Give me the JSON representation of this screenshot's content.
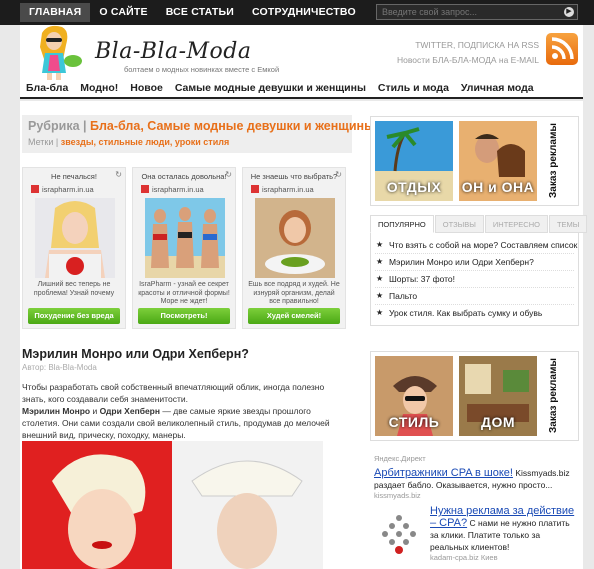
{
  "topnav": {
    "items": [
      "ГЛАВНАЯ",
      "О САЙТЕ",
      "ВСЕ СТАТЬИ",
      "СОТРУДНИЧЕСТВО"
    ],
    "search_placeholder": "Введите свой запрос..."
  },
  "header": {
    "logo": "Bla-Bla-Moda",
    "tagline": "болтаем о модных новинках вместе с Емкой",
    "links_line1": "TWITTER, ПОДПИСКА НА RSS",
    "links_line2": "Новости БЛА-БЛА-МОДА на E-MAIL"
  },
  "catnav": {
    "items": [
      "Бла-бла",
      "Модно!",
      "Новое",
      "Самые модные девушки и женщины",
      "Стиль и мода",
      "Уличная мода"
    ]
  },
  "rubric": {
    "prefix": "Рубрика | ",
    "title": "Бла-бла, Самые модные девушки и женщины",
    "tags_prefix": "Метки | ",
    "tags": "звезды, стильные люди, уроки стиля"
  },
  "ads": [
    {
      "title": "Не печалься!",
      "source": "israpharm.in.ua",
      "text": "Лишний вес теперь не проблема! Узнай почему",
      "button": "Похудение без вреда"
    },
    {
      "title": "Она осталась довольна!",
      "source": "israpharm.in.ua",
      "text": "IsraPharm - узнай ее секрет красоты и отличной формы! Море не ждет!",
      "button": "Посмотреть!"
    },
    {
      "title": "Не знаешь что выбрать?",
      "source": "israpharm.in.ua",
      "text": "Ешь все подряд и худей. Не изнуряй организм, делай все правильно!",
      "button": "Худей смелей!"
    }
  ],
  "article": {
    "title": "Мэрилин Монро или Одри Хепберн?",
    "author": "Автор: Bla-Bla-Moda",
    "p1": "Чтобы разработать свой собственный впечатляющий облик, иногда полезно знать, кого создавали себя знаменитости.",
    "p2_bold1": "Мэрилин Монро",
    "p2_and": " и ",
    "p2_bold2": "Одри Хепберн",
    "p2_rest": " — две самые яркие звезды прошлого столетия. Они сами создали свой великолепный стиль, продумав до мелочей внешний вид, прическу, походку, манеры."
  },
  "side_banner1": {
    "cap1": "ОТДЫХ",
    "cap2": "ОН и ОНА",
    "side": "Заказ рекламы"
  },
  "side_banner2": {
    "cap1": "СТИЛЬ",
    "cap2": "ДОМ",
    "side": "Заказ рекламы"
  },
  "tabs": {
    "labels": [
      "ПОПУЛЯРНО",
      "ОТЗЫВЫ",
      "ИНТЕРЕСНО",
      "ТЕМЫ"
    ],
    "items": [
      "Что взять с собой на море? Составляем список",
      "Мэрилин Монро или Одри Хепберн?",
      "Шорты: 37 фото!",
      "Пальто",
      "Урок стиля. Как выбрать сумку и обувь"
    ]
  },
  "yandex": {
    "label": "Яндекс.Директ",
    "ad1": {
      "headline": "Арбитражники CPA в шоке!",
      "desc_lead": " Kissmyads.biz раздает бабло. Оказывается, нужно просто...",
      "url": "kissmyads.biz"
    },
    "ad2": {
      "headline": "Нужна реклама за действие – CPA?",
      "desc": " С нами не нужно платить за клики. Платите только за реальных клиентов!",
      "url": "kadam-cpa.biz  Киев"
    }
  }
}
